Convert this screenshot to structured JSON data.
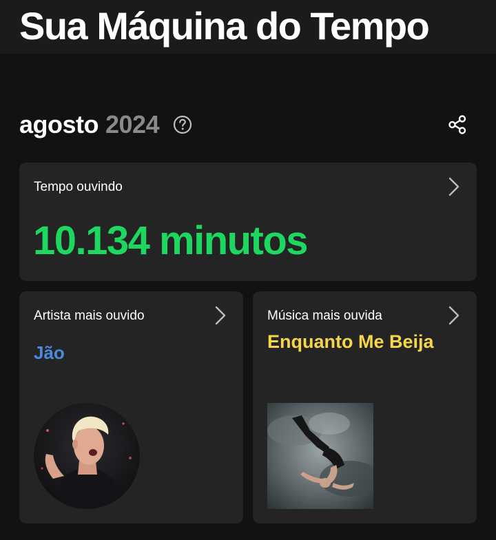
{
  "header": {
    "title": "Sua Máquina do Tempo"
  },
  "period": {
    "month": "agosto",
    "year": "2024"
  },
  "icons": {
    "help": "help-circle-icon",
    "share": "share-icon",
    "chevron": "chevron-right-icon"
  },
  "cards": {
    "listening_time": {
      "label": "Tempo ouvindo",
      "value": "10.134 minutos"
    },
    "top_artist": {
      "label": "Artista mais ouvido",
      "name": "Jão"
    },
    "top_song": {
      "label": "Música mais ouvida",
      "name": "Enquanto Me Beija"
    }
  },
  "colors": {
    "background": "#121212",
    "card": "#242424",
    "minutes_green": "#1ed760",
    "artist_blue": "#4b8bde",
    "song_yellow": "#f5d64a"
  }
}
